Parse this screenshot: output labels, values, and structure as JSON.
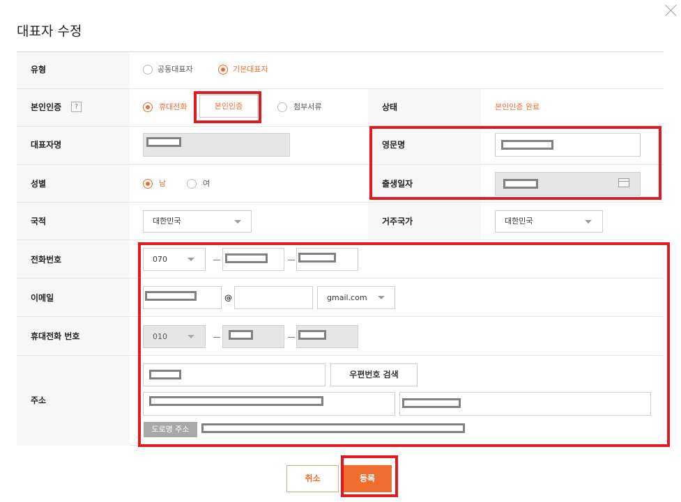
{
  "dialog": {
    "title": "대표자 수정"
  },
  "type_row": {
    "label": "유형",
    "options": [
      "공동대표자",
      "기본대표자"
    ],
    "selected": "기본대표자"
  },
  "auth_row": {
    "label": "본인인증",
    "help": "?",
    "opt_phone": "휴대전화",
    "auth_button": "본인인증",
    "opt_docs": "첨부서류",
    "status_label": "상태",
    "status_value": "본인인증 완료"
  },
  "name_row": {
    "label": "대표자명",
    "english_label": "영문명"
  },
  "gender_row": {
    "label": "성별",
    "male": "남",
    "female": "여",
    "birth_label": "출생일자"
  },
  "nation_row": {
    "label": "국적",
    "value": "대한민국",
    "residence_label": "거주국가",
    "residence_value": "대한민국"
  },
  "phone_row": {
    "label": "전화번호",
    "area_code": "070"
  },
  "email_row": {
    "label": "이메일",
    "at": "@",
    "domain": "gmail.com"
  },
  "mobile_row": {
    "label": "휴대전화 번호",
    "prefix": "010"
  },
  "address_row": {
    "label": "주소",
    "zip_button": "우편번호 검색",
    "road_tag": "도로명 주소"
  },
  "actions": {
    "cancel": "취소",
    "submit": "등록"
  },
  "colors": {
    "accent": "#ef6d2f",
    "highlight": "#e2191f"
  }
}
